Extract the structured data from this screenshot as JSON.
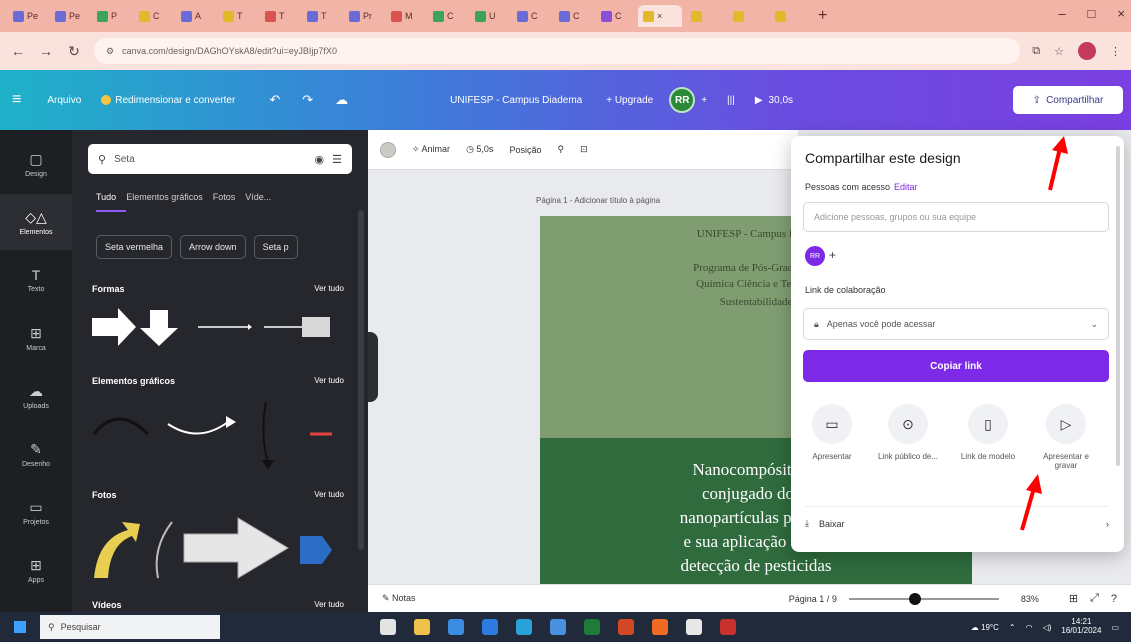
{
  "browser": {
    "tabs": [
      {
        "label": "Pe",
        "color": "#6b6bd8"
      },
      {
        "label": "Pe",
        "color": "#6b6bd8"
      },
      {
        "label": "P",
        "color": "#3aa55a"
      },
      {
        "label": "C",
        "color": "#e2b92b"
      },
      {
        "label": "A",
        "color": "#6b6bd8"
      },
      {
        "label": "T",
        "color": "#e2b92b"
      },
      {
        "label": "T",
        "color": "#d9534f"
      },
      {
        "label": "T",
        "color": "#6b6bd8"
      },
      {
        "label": "Pr",
        "color": "#6b6bd8"
      },
      {
        "label": "M",
        "color": "#d9534f"
      },
      {
        "label": "C",
        "color": "#3aa55a"
      },
      {
        "label": "U",
        "color": "#3aa55a"
      },
      {
        "label": "C",
        "color": "#6b6bd8"
      },
      {
        "label": "C",
        "color": "#6b6bd8"
      },
      {
        "label": "C",
        "color": "#8a4fd8"
      },
      {
        "label": "×",
        "color": "#e2b92b",
        "active": true
      },
      {
        "label": "",
        "color": "#e2b92b"
      },
      {
        "label": "",
        "color": "#e2b92b"
      },
      {
        "label": "",
        "color": "#e2b92b"
      }
    ],
    "new_tab": "+",
    "window_controls": [
      "–",
      "□",
      "×"
    ],
    "address": "canva.com/design/DAGhOYskA8/edit?ui=eyJBIjp7fX0",
    "nav": {
      "back": "←",
      "forward": "→",
      "reload": "↻"
    }
  },
  "canva_header": {
    "menu_icon": "≡",
    "file": "Arquivo",
    "resize": "Redimensionar e converter",
    "undo": "↶",
    "redo": "↷",
    "cloud": "☁",
    "doc_title": "UNIFESP - Campus Diadema",
    "upgrade": "+ Upgrade",
    "avatar": "RR",
    "plus": "+",
    "stats_icon": "|||",
    "present": "30,0s",
    "share": "Compartilhar"
  },
  "rail": [
    {
      "label": "Design",
      "icon": "▢"
    },
    {
      "label": "Elementos",
      "icon": "◇△",
      "active": true
    },
    {
      "label": "Texto",
      "icon": "T"
    },
    {
      "label": "Marca",
      "icon": "⊞"
    },
    {
      "label": "Uploads",
      "icon": "☁"
    },
    {
      "label": "Desenho",
      "icon": "✎"
    },
    {
      "label": "Projetos",
      "icon": "▭"
    },
    {
      "label": "Apps",
      "icon": "⊞"
    }
  ],
  "elements_panel": {
    "search_value": "Seta",
    "categories": [
      "Tudo",
      "Elementos gráficos",
      "Fotos",
      "Víde..."
    ],
    "chips": [
      "Seta vermelha",
      "Arrow down",
      "Seta p"
    ],
    "sections": [
      {
        "title": "Formas",
        "see_all": "Ver tudo"
      },
      {
        "title": "Elementos gráficos",
        "see_all": "Ver tudo"
      },
      {
        "title": "Fotos",
        "see_all": "Ver tudo"
      },
      {
        "title": "Vídeos",
        "see_all": "Ver tudo"
      }
    ]
  },
  "editor_toolbar": {
    "animate": "Animar",
    "duration": "5,0s",
    "position": "Posição",
    "paint_icon": "⚲",
    "lock_icon": "🔒"
  },
  "page": {
    "label": "Página 1 - Adicionar título à página",
    "top_lines": [
      "UNIFESP - Campus Diade",
      "Programa de Pós-Graduação",
      "Química Ciência e Tecnolo",
      "Sustentabilidade"
    ],
    "bottom_lines": [
      "Nanocompósitos d",
      "conjugado dopa",
      "nanopartículas plasmô",
      "e sua aplicação como",
      "detecção de pesticidas"
    ]
  },
  "share_popup": {
    "title": "Compartilhar este design",
    "people_label": "Pessoas com acesso",
    "edit": "Editar",
    "input_placeholder": "Adicione pessoas, grupos ou sua equipe",
    "avatar": "RR",
    "plus": "+",
    "collab_label": "Link de colaboração",
    "link_access": "Apenas você pode acessar",
    "copy_button": "Copiar link",
    "options": [
      {
        "label": "Apresentar",
        "icon": "▭"
      },
      {
        "label": "Link público de...",
        "icon": "⊙"
      },
      {
        "label": "Link de modelo",
        "icon": "▯"
      },
      {
        "label": "Apresentar e gravar",
        "icon": "▷"
      }
    ],
    "download": "Baixar",
    "chevron": "›"
  },
  "footer": {
    "notes": "Notas",
    "pages": "Página 1 / 9",
    "zoom": "83%"
  },
  "taskbar": {
    "search": "Pesquisar",
    "weather": "19°C",
    "time": "14:21",
    "date": "16/01/2024"
  },
  "colors": {
    "annotation_arrow": "#ff0000",
    "canva_purple": "#7d2ae8"
  }
}
